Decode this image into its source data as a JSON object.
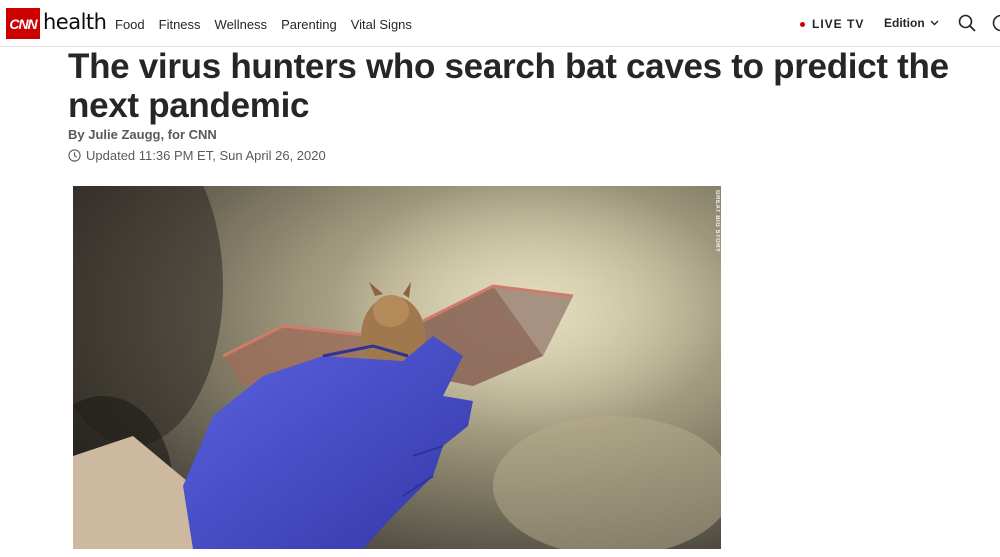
{
  "header": {
    "logo_text": "CNN",
    "section_title": "health",
    "nav": [
      "Food",
      "Fitness",
      "Wellness",
      "Parenting",
      "Vital Signs"
    ],
    "live_tv": "LIVE TV",
    "edition": "Edition",
    "live_color": "#cc0000"
  },
  "article": {
    "headline": "The virus hunters who search bat caves to predict the next pandemic",
    "byline": "By Julie Zaugg, for CNN",
    "updated": "Updated 11:36 PM ET, Sun April 26, 2020"
  },
  "video": {
    "credit": "GREAT BIG STORY",
    "play_icon": "play-icon"
  }
}
